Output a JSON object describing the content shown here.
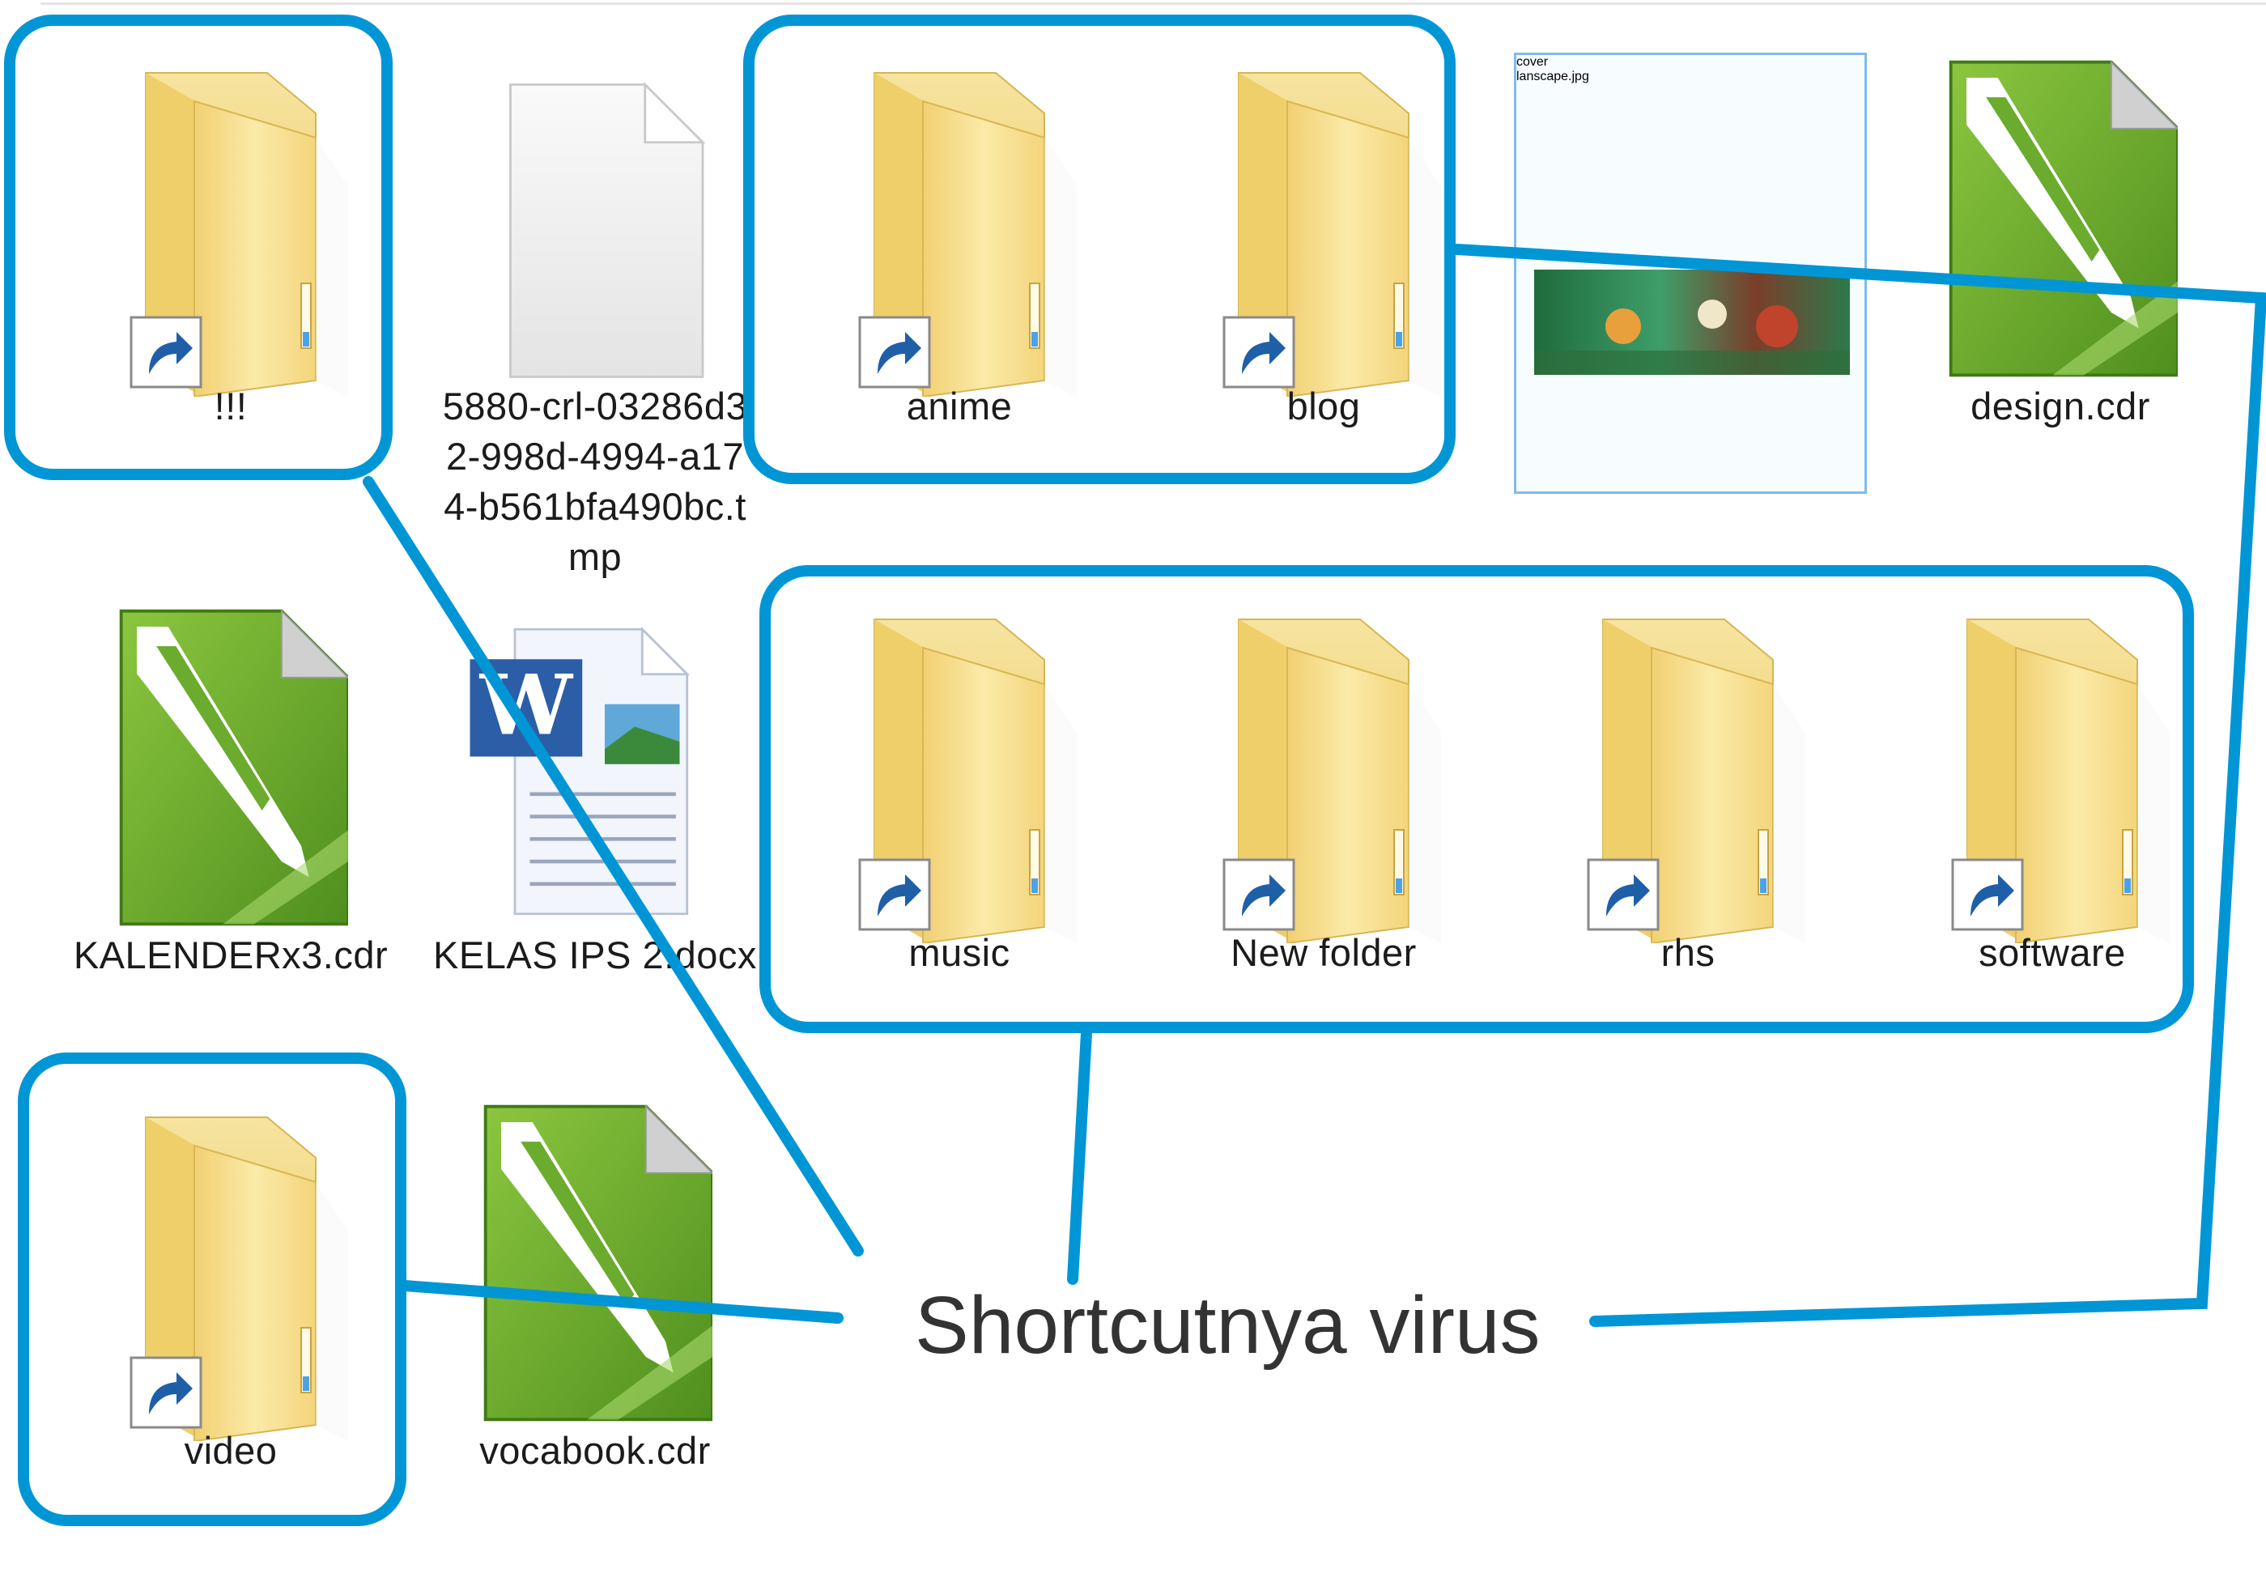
{
  "files": [
    {
      "name": "!!!",
      "type": "folder",
      "shortcut": true
    },
    {
      "name": "5880-crl-03286d32-998d-4994-a174-b561bfa490bc.tmp",
      "type": "file",
      "shortcut": false
    },
    {
      "name": "anime",
      "type": "folder",
      "shortcut": true
    },
    {
      "name": "blog",
      "type": "folder",
      "shortcut": true
    },
    {
      "name": "cover lanscape.jpg",
      "type": "image",
      "shortcut": false,
      "selected": true
    },
    {
      "name": "design.cdr",
      "type": "cdr",
      "shortcut": false
    },
    {
      "name": "KALENDERx3.cdr",
      "type": "cdr",
      "shortcut": false
    },
    {
      "name": "KELAS IPS 2.docx",
      "type": "docx",
      "shortcut": false
    },
    {
      "name": "music",
      "type": "folder",
      "shortcut": true
    },
    {
      "name": "New folder",
      "type": "folder",
      "shortcut": true
    },
    {
      "name": "rhs",
      "type": "folder",
      "shortcut": true
    },
    {
      "name": "software",
      "type": "folder",
      "shortcut": true
    },
    {
      "name": "video",
      "type": "folder",
      "shortcut": true
    },
    {
      "name": "vocabook.cdr",
      "type": "cdr",
      "shortcut": false
    }
  ],
  "labels": {
    "f0": "!!!",
    "f1a": "5880-crl-03286d3",
    "f1b": "2-998d-4994-a17",
    "f1c": "4-b561bfa490bc.t",
    "f1d": "mp",
    "f2": "anime",
    "f3": "blog",
    "f4a": "cover",
    "f4b": "lanscape.jpg",
    "f5": "design.cdr",
    "f6": "KALENDERx3.cdr",
    "f7": "KELAS IPS 2.docx",
    "f8": "music",
    "f9": "New folder",
    "f10": "rhs",
    "f11": "software",
    "f12": "video",
    "f13": "vocabook.cdr"
  },
  "annotation": {
    "text": "Shortcutnya virus",
    "color": "#0096d6"
  },
  "colors": {
    "callout": "#0096d6",
    "folder": "#f6df8e",
    "cdr_green": "#6bab2e",
    "selection_border": "#7fbbef"
  }
}
